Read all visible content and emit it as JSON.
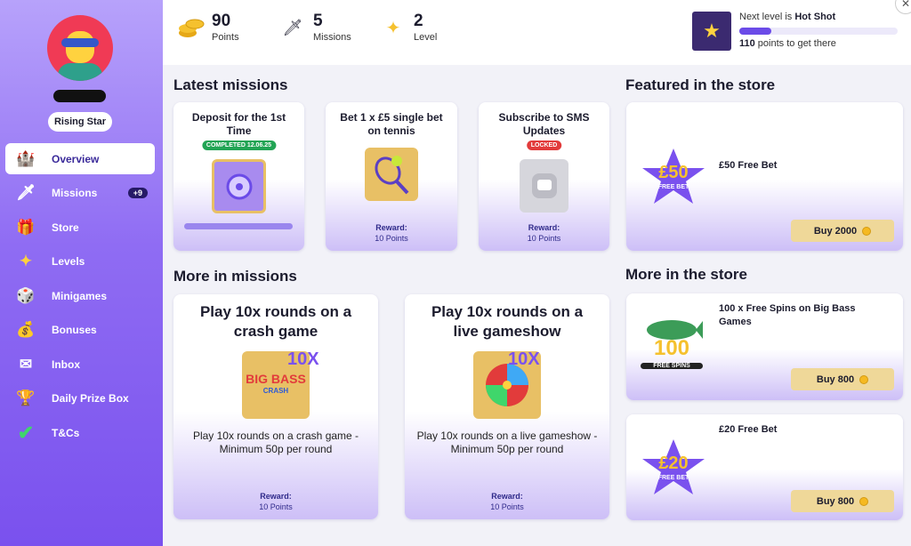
{
  "sidebar": {
    "rank": "Rising Star",
    "items": [
      {
        "label": "Overview",
        "icon": "castle-icon",
        "badge": "",
        "active": true
      },
      {
        "label": "Missions",
        "icon": "sword-icon",
        "badge": "+9"
      },
      {
        "label": "Store",
        "icon": "gift-icon",
        "badge": ""
      },
      {
        "label": "Levels",
        "icon": "sparkle-icon",
        "badge": ""
      },
      {
        "label": "Minigames",
        "icon": "dice-icon",
        "badge": ""
      },
      {
        "label": "Bonuses",
        "icon": "money-bag-icon",
        "badge": ""
      },
      {
        "label": "Inbox",
        "icon": "envelope-icon",
        "badge": ""
      },
      {
        "label": "Daily Prize Box",
        "icon": "trophy-icon",
        "badge": ""
      },
      {
        "label": "T&Cs",
        "icon": "checkmark-icon",
        "badge": ""
      }
    ]
  },
  "header": {
    "stats": [
      {
        "value": "90",
        "label": "Points",
        "icon": "coins-icon"
      },
      {
        "value": "5",
        "label": "Missions",
        "icon": "sword-icon"
      },
      {
        "value": "2",
        "label": "Level",
        "icon": "sparkle-icon"
      }
    ],
    "level": {
      "prefix": "Next level is ",
      "name": "Hot Shot",
      "progress": 0.2,
      "points_needed": "110",
      "points_suffix": " points to get there"
    }
  },
  "latest_missions": {
    "title": "Latest missions",
    "cards": [
      {
        "title": "Deposit for the 1st Time",
        "tag": "COMPLETED 12.06.25",
        "tag_color": "#22a454"
      },
      {
        "title": "Bet 1 x £5 single bet on tennis",
        "reward_label": "Reward:",
        "reward_value": "10 Points"
      },
      {
        "title": "Subscribe to SMS Updates",
        "tag": "LOCKED",
        "tag_color": "#e23b3b",
        "reward_label": "Reward:",
        "reward_value": "10 Points"
      }
    ]
  },
  "more_missions": {
    "title": "More in missions",
    "cards": [
      {
        "title": "Play 10x rounds on a crash game",
        "badge": "10X",
        "game": "BIG BASS",
        "game_sub": "CRASH",
        "desc": "Play 10x rounds on a crash game - Minimum 50p per round",
        "reward_label": "Reward:",
        "reward_value": "10 Points"
      },
      {
        "title": "Play 10x rounds on a live gameshow",
        "badge": "10X",
        "desc": "Play 10x rounds on a live gameshow - Minimum 50p per round",
        "reward_label": "Reward:",
        "reward_value": "10 Points"
      }
    ]
  },
  "featured_store": {
    "title": "Featured in the store",
    "item": {
      "title": "£50 Free Bet",
      "price_label": "Buy 2000",
      "badge_value": "£50",
      "badge_sub": "FREE BET"
    }
  },
  "more_store": {
    "title": "More in the store",
    "items": [
      {
        "title": "100 x Free Spins on Big Bass Games",
        "price_label": "Buy 800",
        "badge_value": "100",
        "badge_sub": "FREE SPINS"
      },
      {
        "title": "£20 Free Bet",
        "price_label": "Buy 800",
        "badge_value": "£20",
        "badge_sub": "FREE BET"
      }
    ]
  },
  "colors": {
    "accent": "#7a51ee",
    "complete": "#22a454",
    "locked": "#e23b3b",
    "buy_button": "#efd899"
  }
}
